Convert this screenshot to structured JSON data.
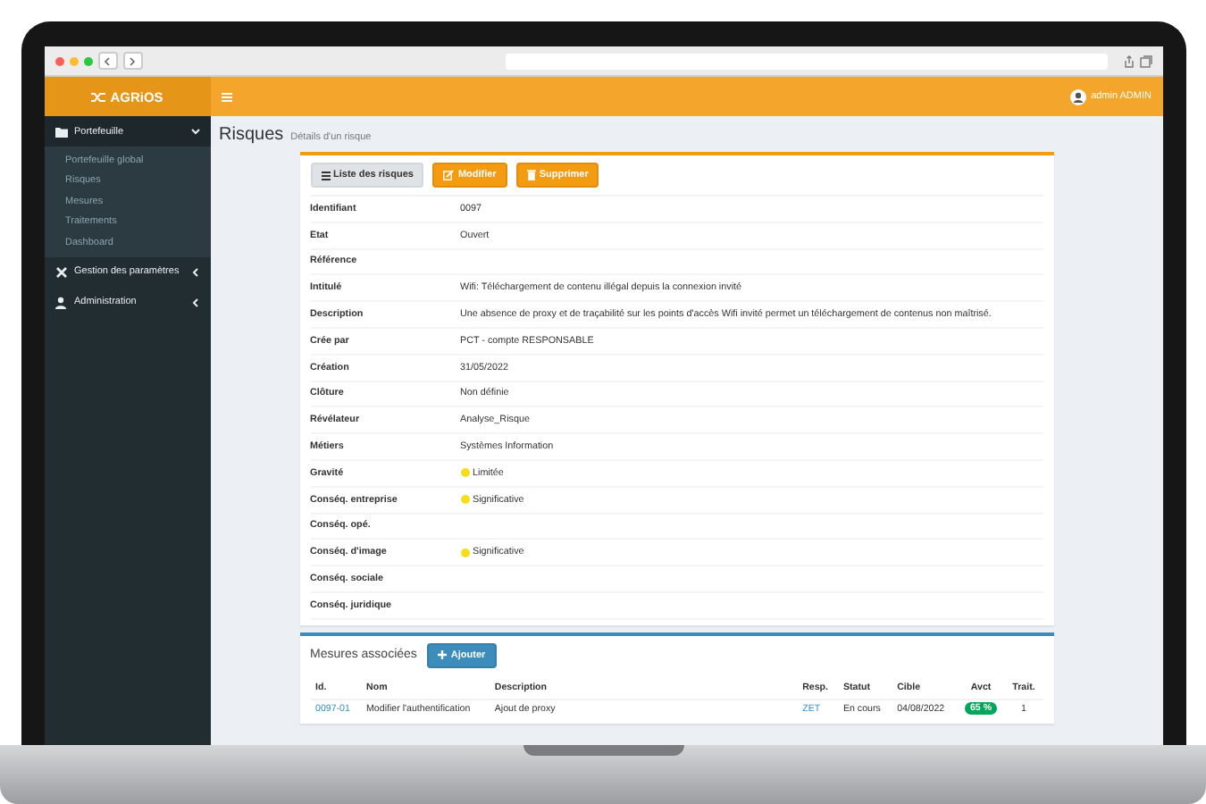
{
  "app": {
    "logo": "AGRiOS",
    "user": "admin ADMIN"
  },
  "sidebar": {
    "items": [
      {
        "label": "Portefeuille",
        "expanded": true,
        "children": [
          {
            "label": "Portefeuille global"
          },
          {
            "label": "Risques"
          },
          {
            "label": "Mesures"
          },
          {
            "label": "Traitements"
          },
          {
            "label": "Dashboard"
          }
        ]
      },
      {
        "label": "Gestion des paramètres",
        "expanded": false
      },
      {
        "label": "Administration",
        "expanded": false
      }
    ]
  },
  "page": {
    "title": "Risques",
    "subtitle": "Détails d'un risque"
  },
  "actions": [
    {
      "label": "Liste des risques",
      "kind": "list"
    },
    {
      "label": "Modifier",
      "kind": "edit"
    },
    {
      "label": "Supprimer",
      "kind": "delete"
    }
  ],
  "details": [
    {
      "label": "Identifiant",
      "value": "0097"
    },
    {
      "label": "Etat",
      "value": "Ouvert"
    },
    {
      "label": "Référence"
    },
    {
      "label": "Intitulé",
      "value": "Wifi: Téléchargement de contenu illégal depuis la connexion invité"
    },
    {
      "label": "Description",
      "value": "Une absence de proxy et de traçabilité sur les points d'accès Wifi invité permet un téléchargement de contenus non maîtrisé."
    },
    {
      "label": "Crée par",
      "value": "PCT - compte RESPONSABLE"
    },
    {
      "label": "Création",
      "value": "31/05/2022"
    },
    {
      "label": "Clôture",
      "value": "Non définie"
    },
    {
      "label": "Révélateur",
      "value": "Analyse_Risque"
    },
    {
      "label": "Métiers",
      "value": "Systèmes Information"
    },
    {
      "label": "Gravité",
      "value": "Limitée",
      "color": "#f5de19"
    },
    {
      "label": "Conséq. entreprise",
      "value": "Significative",
      "color": "#f5de19"
    },
    {
      "label": "Conséq. opé."
    },
    {
      "label": "Conséq. d'image",
      "value": "Significative",
      "color": "#f5de19"
    },
    {
      "label": "Conséq. sociale"
    },
    {
      "label": "Conséq. juridique"
    }
  ],
  "measures": {
    "title": "Mesures associées",
    "add_button": "Ajouter",
    "columns": [
      "Id.",
      "Nom",
      "Description",
      "Resp.",
      "Statut",
      "Cible",
      "Avct",
      "Trait."
    ],
    "rows": [
      {
        "id": "0097-01",
        "name": "Modifier l'authentification",
        "description": "Ajout de proxy",
        "resp": "ZET",
        "status": "En cours",
        "target": "04/08/2022",
        "progress": "65 %",
        "treatments": "1"
      }
    ]
  }
}
